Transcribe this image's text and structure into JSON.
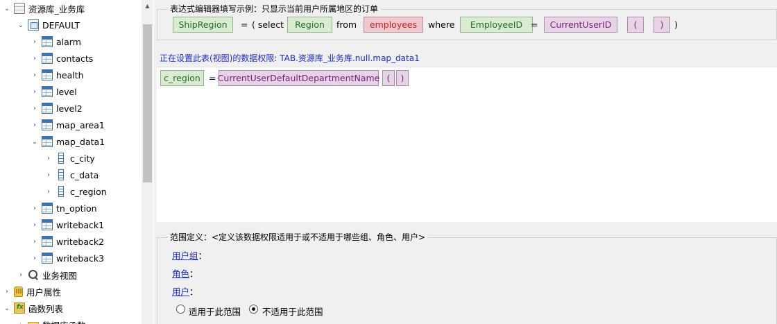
{
  "tree": {
    "root": "资源库_业务库",
    "schema": "DEFAULT",
    "tables": [
      "alarm",
      "contacts",
      "health",
      "level",
      "level2",
      "map_area1",
      "map_data1"
    ],
    "columns": [
      "c_city",
      "c_data",
      "c_region"
    ],
    "tables_after": [
      "tn_option",
      "writeback1",
      "writeback2",
      "writeback3"
    ],
    "business_view": "业务视图",
    "user_attrs": "用户属性",
    "func_list": "函数列表",
    "db_funcs": "数据库函数"
  },
  "example": {
    "title": "表达式编辑器填写示例：只显示当前用户所属地区的订单",
    "field1": "ShipRegion",
    "eq1": "=",
    "open_select": "( select",
    "field2": "Region",
    "from": "from",
    "table": "employees",
    "where": "where",
    "field3": "EmployeeID",
    "eq2": "=",
    "func": "CurrentUserID",
    "paren_open": "(",
    "paren_close": ")",
    "close": ")"
  },
  "permission_label": "正在设置此表(视图)的数据权限: TAB.资源库_业务库.null.map_data1",
  "editor": {
    "field": "c_region",
    "eq": "=",
    "func": "CurrentUserDefaultDepartmentName",
    "paren_open": "(",
    "paren_close": ")"
  },
  "scope": {
    "title": "范围定义：<定义该数据权限适用于或不适用于哪些组、角色、用户>",
    "user_group": "用户组",
    "role": "角色",
    "user": "用户",
    "colon": "：",
    "option_apply": "适用于此范围",
    "option_not_apply": "不适用于此范围",
    "selected": "option_not_apply"
  }
}
